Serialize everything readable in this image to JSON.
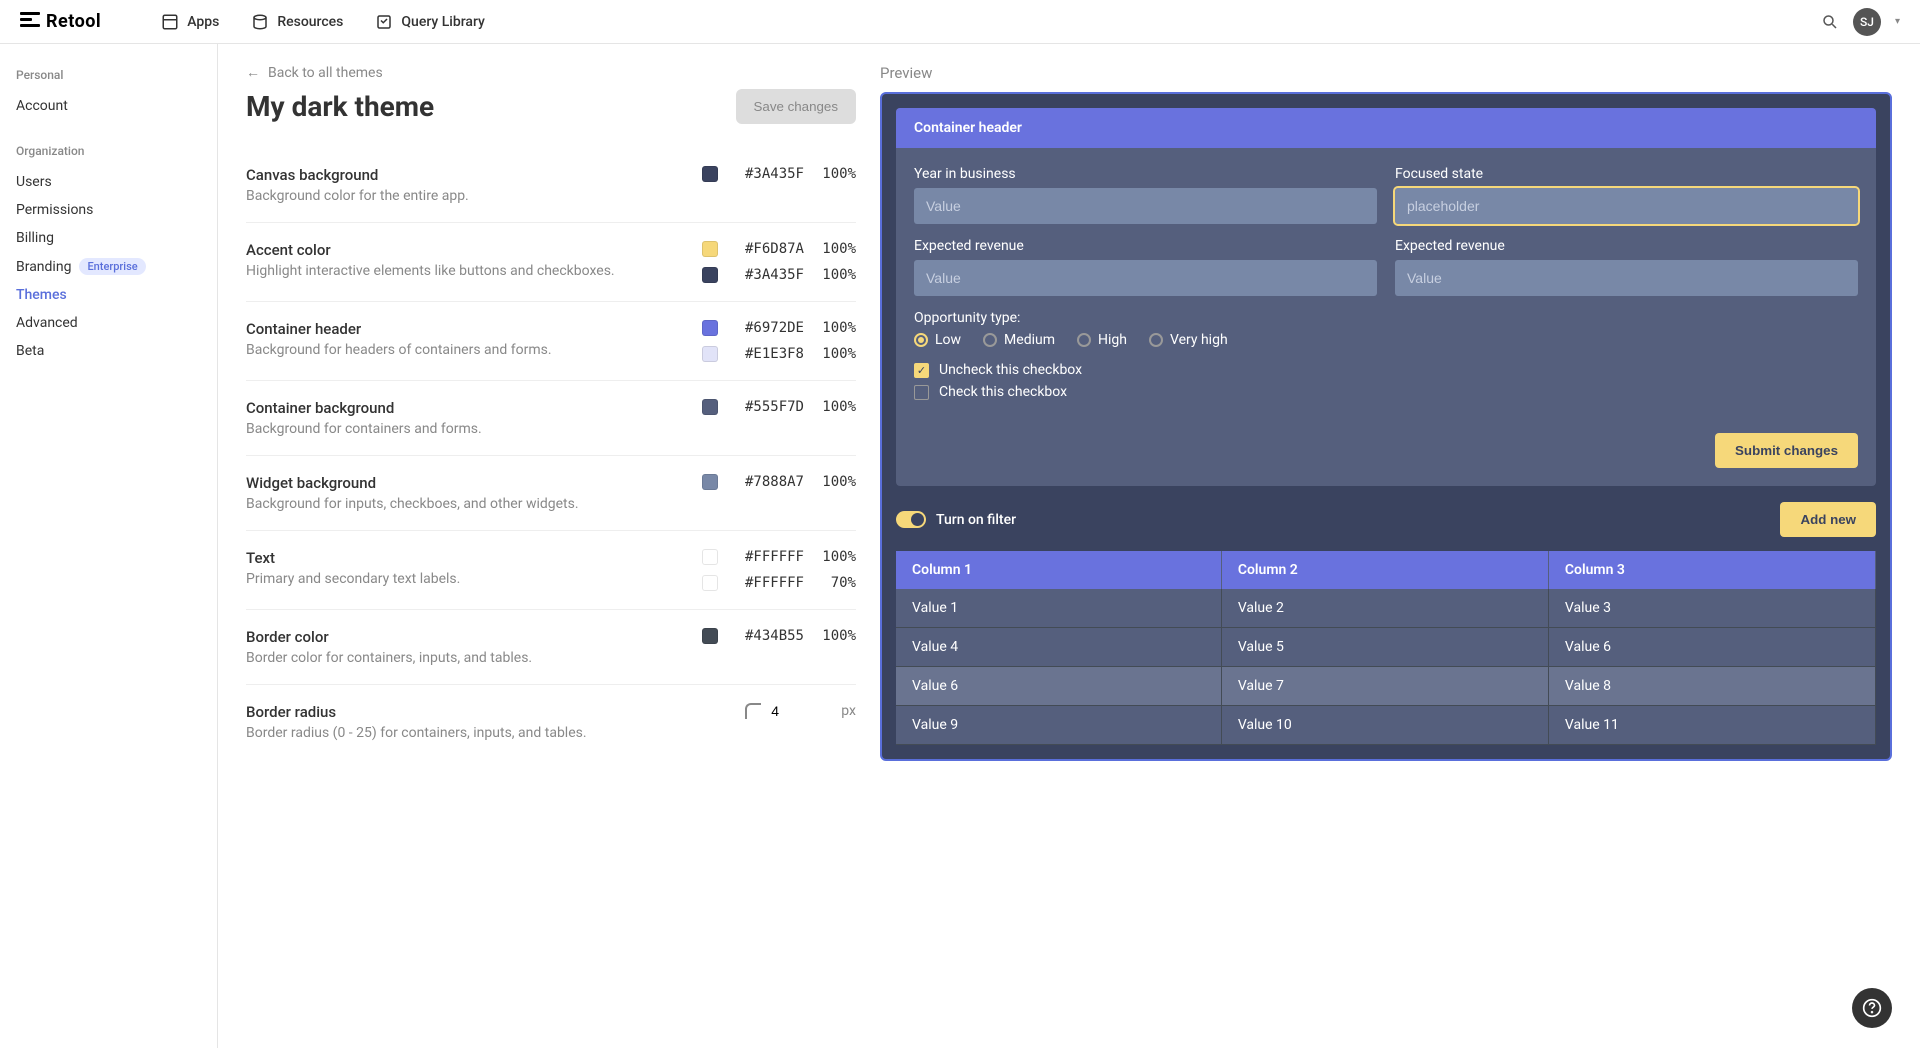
{
  "brand": "Retool",
  "nav": {
    "apps": "Apps",
    "resources": "Resources",
    "query_library": "Query Library"
  },
  "avatar_initials": "SJ",
  "sidebar": {
    "personal_label": "Personal",
    "personal": {
      "account": "Account"
    },
    "org_label": "Organization",
    "org": {
      "users": "Users",
      "permissions": "Permissions",
      "billing": "Billing",
      "branding": "Branding",
      "branding_badge": "Enterprise",
      "themes": "Themes",
      "advanced": "Advanced",
      "beta": "Beta"
    }
  },
  "back_link": "Back to all themes",
  "page_title": "My dark theme",
  "save_button": "Save changes",
  "settings": [
    {
      "name": "Canvas background",
      "desc": "Background color for the entire app.",
      "colors": [
        {
          "hex": "#3A435F",
          "opacity": "100%"
        }
      ]
    },
    {
      "name": "Accent color",
      "desc": "Highlight interactive elements like buttons and checkboxes.",
      "colors": [
        {
          "hex": "#F6D87A",
          "opacity": "100%"
        },
        {
          "hex": "#3A435F",
          "opacity": "100%"
        }
      ]
    },
    {
      "name": "Container header",
      "desc": "Background for headers of containers and forms.",
      "colors": [
        {
          "hex": "#6972DE",
          "opacity": "100%"
        },
        {
          "hex": "#E1E3F8",
          "opacity": "100%"
        }
      ]
    },
    {
      "name": "Container background",
      "desc": "Background for containers and forms.",
      "colors": [
        {
          "hex": "#555F7D",
          "opacity": "100%"
        }
      ]
    },
    {
      "name": "Widget background",
      "desc": "Background for inputs, checkboes, and other widgets.",
      "colors": [
        {
          "hex": "#7888A7",
          "opacity": "100%"
        }
      ]
    },
    {
      "name": "Text",
      "desc": "Primary and secondary text labels.",
      "colors": [
        {
          "hex": "#FFFFFF",
          "opacity": "100%"
        },
        {
          "hex": "#FFFFFF",
          "opacity": "70%"
        }
      ]
    },
    {
      "name": "Border color",
      "desc": "Border color for containers, inputs, and tables.",
      "colors": [
        {
          "hex": "#434B55",
          "opacity": "100%"
        }
      ]
    }
  ],
  "radius": {
    "name": "Border radius",
    "desc": "Border radius (0 - 25) for containers, inputs, and tables.",
    "value": "4",
    "unit": "px"
  },
  "preview": {
    "label": "Preview",
    "container_header": "Container header",
    "fields": {
      "year_label": "Year in business",
      "year_placeholder": "Value",
      "focused_label": "Focused state",
      "focused_placeholder": "placeholder",
      "rev1_label": "Expected revenue",
      "rev1_placeholder": "Value",
      "rev2_label": "Expected revenue",
      "rev2_placeholder": "Value"
    },
    "opportunity_label": "Opportunity type:",
    "radios": {
      "low": "Low",
      "medium": "Medium",
      "high": "High",
      "very_high": "Very high"
    },
    "uncheck_cb": "Uncheck this checkbox",
    "check_cb": "Check this checkbox",
    "submit": "Submit changes",
    "toggle_label": "Turn on filter",
    "add_new": "Add new",
    "table_headers": [
      "Column 1",
      "Column 2",
      "Column 3"
    ],
    "table_rows": [
      [
        "Value 1",
        "Value 2",
        "Value 3"
      ],
      [
        "Value 4",
        "Value 5",
        "Value 6"
      ],
      [
        "Value 6",
        "Value 7",
        "Value 8"
      ],
      [
        "Value 9",
        "Value 10",
        "Value 11"
      ]
    ]
  }
}
